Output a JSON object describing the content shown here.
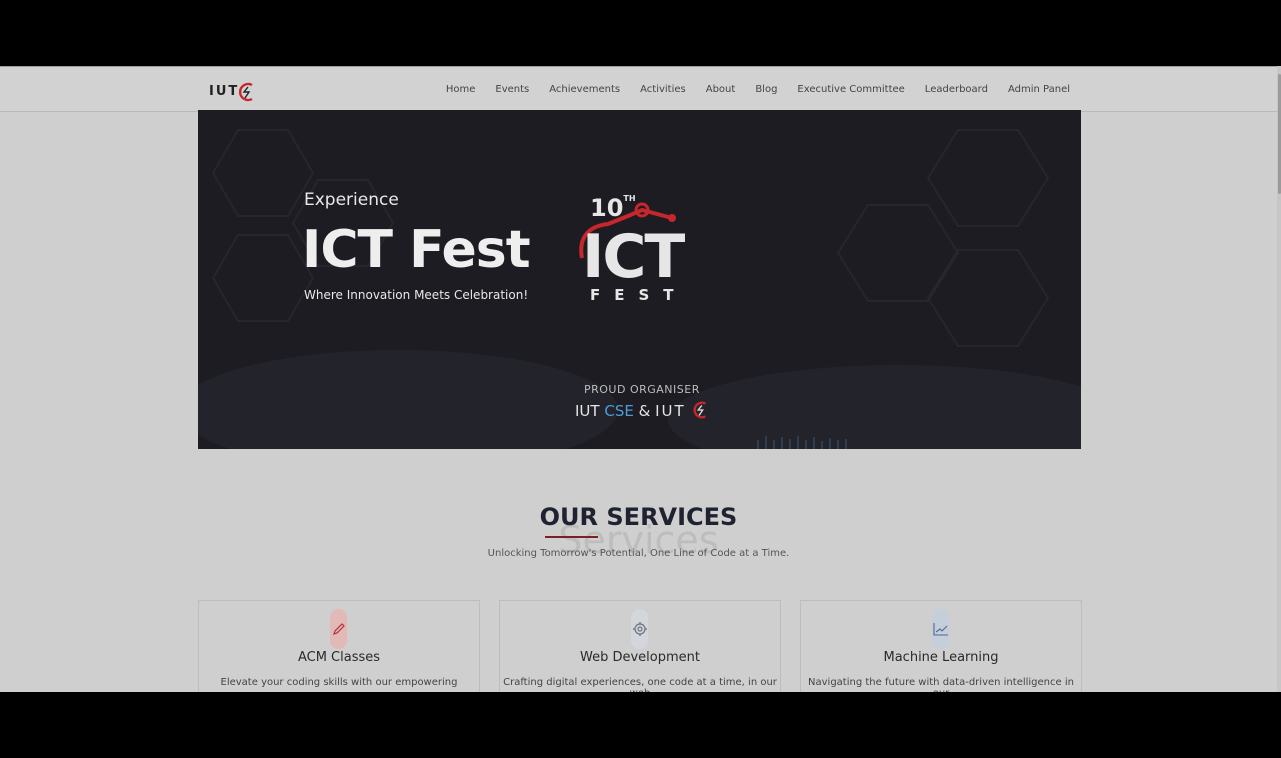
{
  "nav": {
    "logo_text": "IUT",
    "links": [
      "Home",
      "Events",
      "Achievements",
      "Activities",
      "About",
      "Blog",
      "Executive Committee",
      "Leaderboard",
      "Admin Panel"
    ]
  },
  "hero": {
    "experience": "Experience",
    "title": "ICT Fest",
    "subtitle": "Where Innovation Meets Celebration!",
    "badge_10th": "10",
    "badge_th": "TH",
    "badge_ict": "ICT",
    "badge_fest": "FEST",
    "organiser_label": "PROUD ORGANISER",
    "org_iut": "IUT",
    "org_cse": "CSE",
    "org_amp": "&",
    "org_iutcs": "IUT"
  },
  "services": {
    "title": "OUR SERVICES",
    "background_word": "Services",
    "subtitle": "Unlocking Tomorrow's Potential, One Line of Code at a Time.",
    "cards": [
      {
        "title": "ACM Classes",
        "text": "Elevate your coding skills with our empowering",
        "icon": "pencil-icon",
        "icon_bg": "#e2b9b6"
      },
      {
        "title": "Web Development",
        "text": "Crafting digital experiences, one code at a time, in our web",
        "icon": "gear-icon",
        "icon_bg": "#d3d7dc"
      },
      {
        "title": "Machine Learning",
        "text": "Navigating the future with data-driven intelligence in our",
        "icon": "chart-icon",
        "icon_bg": "#c5cfdc"
      }
    ]
  },
  "colors": {
    "accent_red": "#c7262c",
    "cse_blue": "#4f9cd9",
    "hero_bg": "#1c1c22"
  }
}
